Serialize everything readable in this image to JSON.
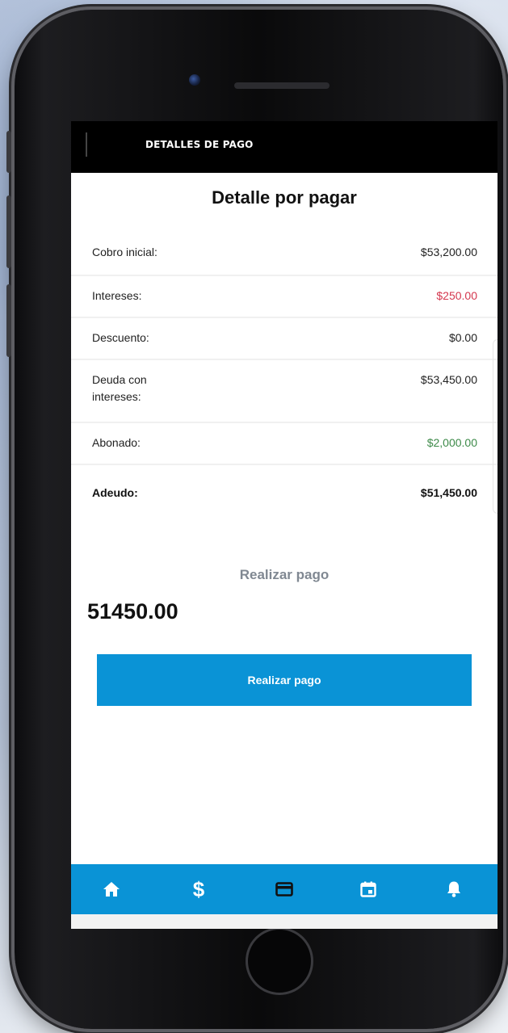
{
  "header": {
    "title": "DETALLES DE PAGO"
  },
  "detail": {
    "heading": "Detalle por pagar",
    "rows": [
      {
        "label": "Cobro inicial:",
        "value": "$53,200.00"
      },
      {
        "label": "Intereses:",
        "value": "$250.00"
      },
      {
        "label": "Descuento:",
        "value": "$0.00"
      },
      {
        "label": "Deuda con\nintereses:",
        "value": "$53,450.00"
      },
      {
        "label": "Abonado:",
        "value": "$2,000.00"
      },
      {
        "label": "Adeudo:",
        "value": "$51,450.00"
      }
    ]
  },
  "payment": {
    "subtitle": "Realizar pago",
    "amount": "51450.00",
    "button_label": "Realizar pago"
  },
  "nav": {
    "items": [
      {
        "icon": "home-icon"
      },
      {
        "icon": "dollar-icon",
        "glyph": "$"
      },
      {
        "icon": "credit-card-icon"
      },
      {
        "icon": "calendar-icon"
      },
      {
        "icon": "bell-icon"
      }
    ]
  },
  "colors": {
    "accent": "#0a93d6",
    "interest": "#d4374e",
    "paid": "#3d8a49"
  }
}
